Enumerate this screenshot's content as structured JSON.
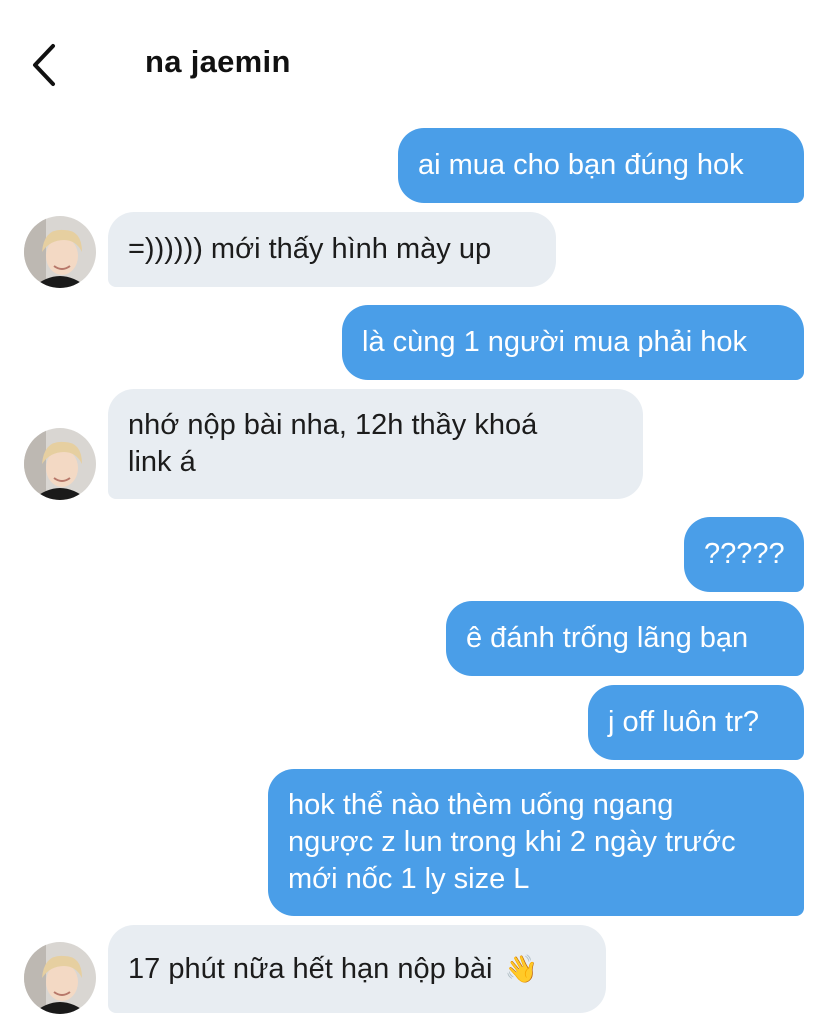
{
  "header": {
    "back_icon": "chevron-left-icon",
    "contact_name": "na jaemin"
  },
  "messages": [
    {
      "from": "me",
      "text": "ai mua cho bạn đúng hok"
    },
    {
      "from": "them",
      "text": "=)))))) mới thấy hình mày up"
    },
    {
      "from": "me",
      "text": "là cùng 1 người mua phải hok"
    },
    {
      "from": "them",
      "lines": [
        "nhớ nộp bài nha, 12h thầy khoá",
        "link á"
      ]
    },
    {
      "from": "me",
      "text": "?????"
    },
    {
      "from": "me",
      "text": "ê đánh trống lãng bạn"
    },
    {
      "from": "me",
      "text": "j off luôn tr?"
    },
    {
      "from": "me",
      "lines": [
        "hok thể nào thèm uống ngang",
        "ngược z lun trong khi 2 ngày trước",
        "mới nốc 1 ly size L"
      ]
    },
    {
      "from": "them",
      "text": "17 phút nữa hết hạn nộp bài",
      "emoji": "👋",
      "emoji_icon": "waving-hand-icon"
    }
  ],
  "colors": {
    "outgoing_bubble": "#4a9ee8",
    "incoming_bubble": "#e8edf2",
    "outgoing_text": "#ffffff",
    "incoming_text": "#1c1c1c"
  }
}
